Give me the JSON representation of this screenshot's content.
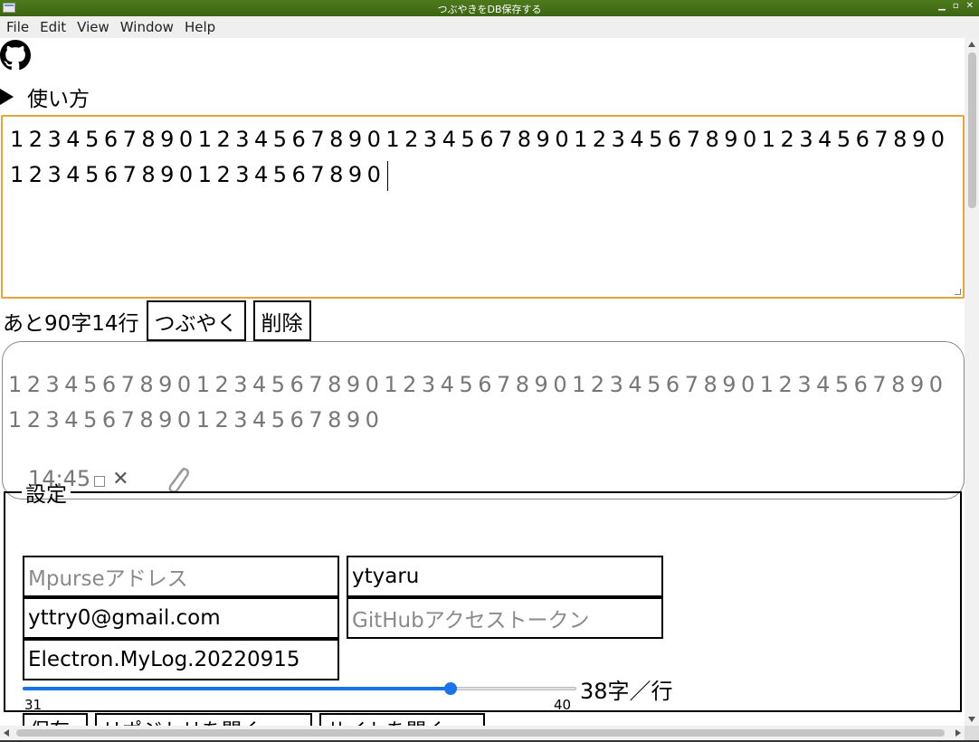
{
  "window": {
    "title": "つぶやきをDB保存する"
  },
  "menu": [
    "File",
    "Edit",
    "View",
    "Window",
    "Help"
  ],
  "howto": {
    "label": "使い方"
  },
  "editor": {
    "value": "1234567890123456789012345678901234567890123456789012345678901234567890"
  },
  "actions": {
    "remaining": "あと90字14行",
    "tweet_label": "つぶやく",
    "delete_label": "削除"
  },
  "post": {
    "text": "1234567890123456789012345678901234567890123456789012345678901234567890",
    "time": "14:45",
    "delete_symbol": "✕"
  },
  "settings": {
    "legend": "設定",
    "mpurse_placeholder": "Mpurseアドレス",
    "github_user": "ytyaru",
    "email": "yttry0@gmail.com",
    "github_token_placeholder": "GitHubアクセストークン",
    "repo": "Electron.MyLog.20220915",
    "slider": {
      "min": "31",
      "max": "40",
      "value": 38
    },
    "per_line": "38字／行",
    "buttons": [
      "保存",
      "リポジトリを開く",
      "サイトを開く"
    ]
  },
  "colors": {
    "accent": "#1a73e8",
    "focus_border": "#e8a33a",
    "titlebar": "#4e7a1c"
  }
}
